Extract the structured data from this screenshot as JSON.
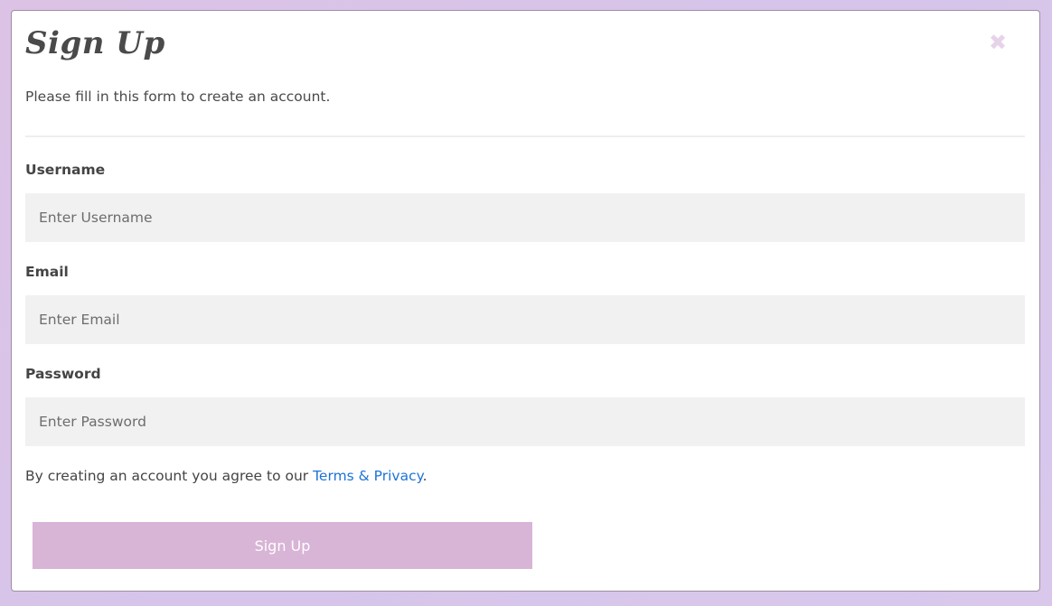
{
  "modal": {
    "close_label": "✖",
    "title": "Sign Up",
    "subtitle": "Please fill in this form to create an account."
  },
  "form": {
    "username_label": "Username",
    "username_placeholder": "Enter Username",
    "email_label": "Email",
    "email_placeholder": "Enter Email",
    "password_label": "Password",
    "password_placeholder": "Enter Password",
    "terms_prefix": "By creating an account you agree to our ",
    "terms_link": "Terms & Privacy",
    "terms_suffix": ".",
    "submit_label": "Sign Up"
  },
  "colors": {
    "background": "#dcc3e6",
    "button": "#d8b4d6",
    "link": "#1e73d8",
    "input_bg": "#f1f1f1"
  }
}
